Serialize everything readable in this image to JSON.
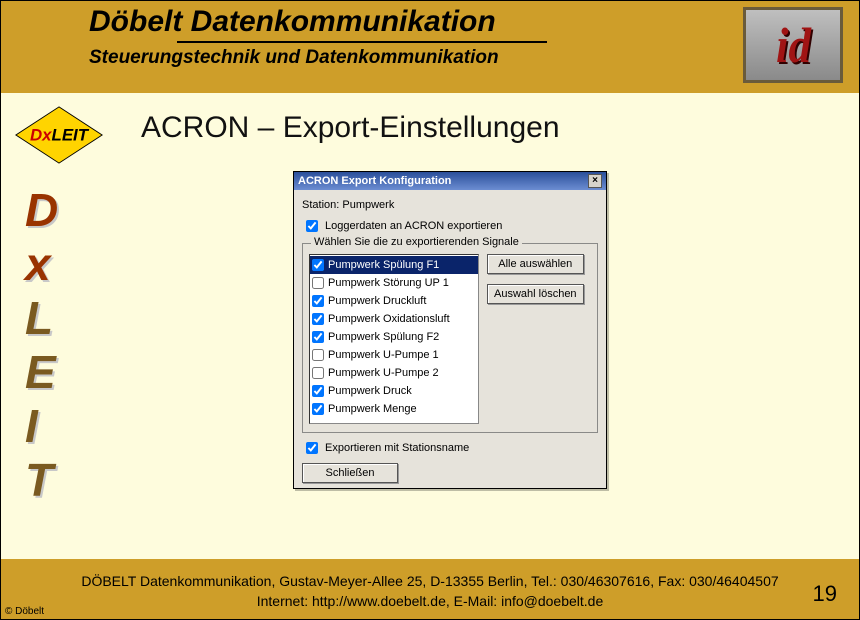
{
  "header": {
    "company": "Döbelt Datenkommunikation",
    "subtitle": "Steuerungstechnik und Datenkommunikation",
    "logo": "id"
  },
  "badge": {
    "text": "DxLEIT"
  },
  "sidebar": [
    "D",
    "x",
    "L",
    "E",
    "I",
    "T"
  ],
  "page_title": "ACRON – Export-Einstellungen",
  "dialog": {
    "title": "ACRON Export Konfiguration",
    "station_label": "Station: Pumpwerk",
    "export_check_label": "Loggerdaten an ACRON exportieren",
    "export_checked": true,
    "group_legend": "Wählen Sie die zu exportierenden Signale",
    "signals": [
      {
        "label": "Pumpwerk Spülung F1",
        "checked": true,
        "selected": true
      },
      {
        "label": "Pumpwerk Störung UP 1",
        "checked": false,
        "selected": false
      },
      {
        "label": "Pumpwerk Druckluft",
        "checked": true,
        "selected": false
      },
      {
        "label": "Pumpwerk Oxidationsluft",
        "checked": true,
        "selected": false
      },
      {
        "label": "Pumpwerk Spülung F2",
        "checked": true,
        "selected": false
      },
      {
        "label": "Pumpwerk U-Pumpe 1",
        "checked": false,
        "selected": false
      },
      {
        "label": "Pumpwerk U-Pumpe 2",
        "checked": false,
        "selected": false
      },
      {
        "label": "Pumpwerk Druck",
        "checked": true,
        "selected": false
      },
      {
        "label": "Pumpwerk Menge",
        "checked": true,
        "selected": false
      }
    ],
    "select_all": "Alle auswählen",
    "clear_sel": "Auswahl löschen",
    "export_with_station_label": "Exportieren mit Stationsname",
    "export_with_station_checked": true,
    "close_btn": "Schließen"
  },
  "footer": {
    "line1": "DÖBELT Datenkommunikation, Gustav-Meyer-Allee 25, D-13355 Berlin, Tel.: 030/46307616, Fax: 030/46404507",
    "line2": "Internet: http://www.doebelt.de, E-Mail: info@doebelt.de",
    "copyright": "© Döbelt",
    "slide_num": "19"
  }
}
